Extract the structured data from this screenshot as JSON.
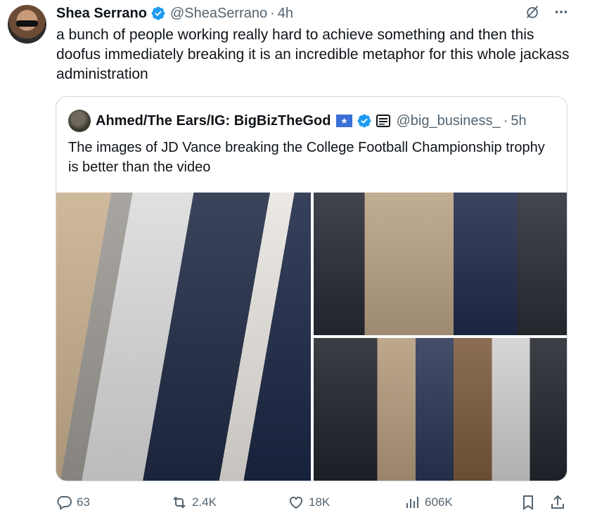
{
  "tweet": {
    "author_name": "Shea Serrano",
    "handle": "@SheaSerrano",
    "separator": "·",
    "time": "4h",
    "text": "a bunch of people working really hard to achieve something and then this doofus immediately breaking it is an incredible metaphor for this whole jackass administration",
    "verified_color": "#1d9bf0"
  },
  "quote": {
    "author_name": "Ahmed/The Ears/IG: BigBizTheGod",
    "handle": "@big_business_",
    "separator": "·",
    "time": "5h",
    "text": "The images of JD Vance breaking the College Football Championship trophy is better than the video",
    "icons": [
      "flag-icon",
      "verified-badge-icon",
      "affiliate-badge-icon"
    ]
  },
  "actions": {
    "replies": "63",
    "reposts": "2.4K",
    "likes": "18K",
    "views": "606K"
  },
  "icons": {
    "top_right": [
      "grok-slash-icon",
      "more-icon"
    ],
    "action_bar": [
      "reply-icon",
      "repost-icon",
      "like-icon",
      "views-icon",
      "bookmark-icon",
      "share-icon"
    ]
  },
  "colors": {
    "text_primary": "#0f1419",
    "text_secondary": "#536471",
    "border": "#cfd9de",
    "accent": "#1d9bf0"
  }
}
